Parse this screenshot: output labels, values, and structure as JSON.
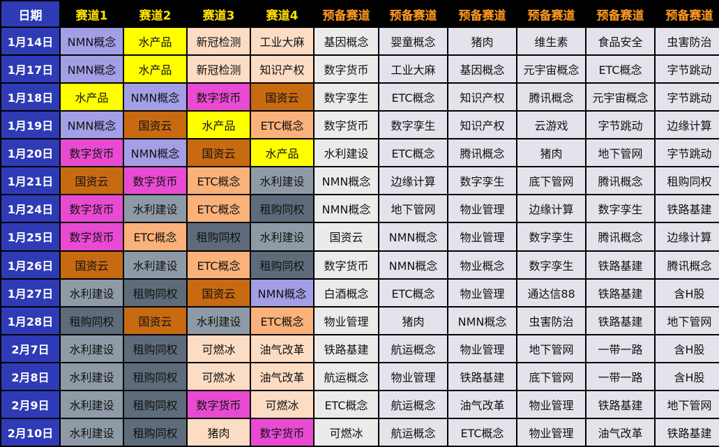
{
  "header": {
    "date": "日期",
    "tracks": [
      "赛道1",
      "赛道2",
      "赛道3",
      "赛道4"
    ],
    "reserve": [
      "预备赛道",
      "预备赛道",
      "预备赛道",
      "预备赛道",
      "预备赛道",
      "预备赛道"
    ]
  },
  "colors": {
    "NMN概念": "#a39fe6",
    "水产品": "#ffff00",
    "新冠检测": "#fddcc4",
    "工业大麻": "#fddcc4",
    "知识产权": "#fddcc4",
    "数字货币": "#e84bd2",
    "国资云": "#c76a12",
    "ETC概念": "#fbb27a",
    "水利建设": "#8e9ba6",
    "租购同权": "#5d6b7a",
    "可燃冰": "#fddcc4",
    "油气改革": "#fddcc4",
    "猪肉": "#fddcc4"
  },
  "rows": [
    {
      "date": "1月14日",
      "tracks": [
        "NMN概念",
        "水产品",
        "新冠检测",
        "工业大麻"
      ],
      "reserve": [
        "基因概念",
        "婴童概念",
        "猪肉",
        "维生素",
        "食品安全",
        "虫害防治"
      ]
    },
    {
      "date": "1月17日",
      "tracks": [
        "NMN概念",
        "水产品",
        "新冠检测",
        "知识产权"
      ],
      "reserve": [
        "数字货币",
        "工业大麻",
        "基因概念",
        "元宇宙概念",
        "ETC概念",
        "字节跳动"
      ]
    },
    {
      "date": "1月18日",
      "tracks": [
        "水产品",
        "NMN概念",
        "数字货币",
        "国资云"
      ],
      "reserve": [
        "数字孪生",
        "ETC概念",
        "知识产权",
        "腾讯概念",
        "元宇宙概念",
        "字节跳动"
      ]
    },
    {
      "date": "1月19日",
      "tracks": [
        "NMN概念",
        "国资云",
        "水产品",
        "ETC概念"
      ],
      "reserve": [
        "数字货币",
        "数字孪生",
        "知识产权",
        "云游戏",
        "字节跳动",
        "边缘计算"
      ]
    },
    {
      "date": "1月20日",
      "tracks": [
        "数字货币",
        "NMN概念",
        "国资云",
        "水产品"
      ],
      "reserve": [
        "水利建设",
        "ETC概念",
        "腾讯概念",
        "猪肉",
        "地下管网",
        "字节跳动"
      ]
    },
    {
      "date": "1月21日",
      "tracks": [
        "国资云",
        "数字货币",
        "ETC概念",
        "水利建设"
      ],
      "reserve": [
        "NMN概念",
        "边缘计算",
        "数字孪生",
        "底下管网",
        "腾讯概念",
        "租购同权"
      ]
    },
    {
      "date": "1月24日",
      "tracks": [
        "数字货币",
        "水利建设",
        "ETC概念",
        "租购同权"
      ],
      "reserve": [
        "NMN概念",
        "地下管网",
        "物业管理",
        "边缘计算",
        "数字孪生",
        "铁路基建"
      ]
    },
    {
      "date": "1月25日",
      "tracks": [
        "数字货币",
        "ETC概念",
        "租购同权",
        "水利建设"
      ],
      "reserve": [
        "国资云",
        "NMN概念",
        "物业管理",
        "数字孪生",
        "腾讯概念",
        "边缘计算"
      ]
    },
    {
      "date": "1月26日",
      "tracks": [
        "国资云",
        "水利建设",
        "ETC概念",
        "租购同权"
      ],
      "reserve": [
        "数字货币",
        "NMN概念",
        "物业概念",
        "数字孪生",
        "铁路基建",
        "腾讯概念"
      ]
    },
    {
      "date": "1月27日",
      "tracks": [
        "水利建设",
        "租购同权",
        "国资云",
        "NMN概念"
      ],
      "reserve": [
        "白酒概念",
        "ETC概念",
        "物业管理",
        "通达信88",
        "铁路基建",
        "含H股"
      ]
    },
    {
      "date": "1月28日",
      "tracks": [
        "租购同权",
        "国资云",
        "水利建设",
        "ETC概念"
      ],
      "reserve": [
        "物业管理",
        "猪肉",
        "NMN概念",
        "虫害防治",
        "铁路基建",
        "地下管网"
      ]
    },
    {
      "date": "2月7日",
      "tracks": [
        "水利建设",
        "租购同权",
        "可燃冰",
        "油气改革"
      ],
      "reserve": [
        "铁路基建",
        "航运概念",
        "物业管理",
        "地下管网",
        "一带一路",
        "含H股"
      ]
    },
    {
      "date": "2月8日",
      "tracks": [
        "水利建设",
        "租购同权",
        "可燃冰",
        "油气改革"
      ],
      "reserve": [
        "航运概念",
        "物业管理",
        "铁路基建",
        "底下管网",
        "一带一路",
        "含H股"
      ]
    },
    {
      "date": "2月9日",
      "tracks": [
        "水利建设",
        "租购同权",
        "数字货币",
        "可燃冰"
      ],
      "reserve": [
        "ETC概念",
        "航运概念",
        "油气改革",
        "物业管理",
        "铁路基建",
        "地下管网"
      ]
    },
    {
      "date": "2月10日",
      "tracks": [
        "水利建设",
        "租购同权",
        "猪肉",
        "数字货币"
      ],
      "reserve": [
        "可燃冰",
        "航运概念",
        "ETC概念",
        "物业管理",
        "油气改革",
        "铁路基建"
      ]
    }
  ]
}
